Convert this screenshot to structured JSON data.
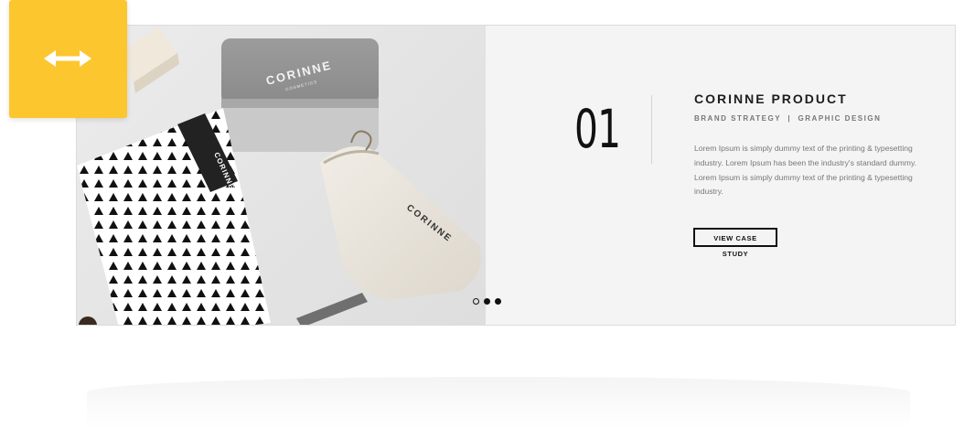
{
  "slide": {
    "number": "01",
    "title": "CORINNE PRODUCT",
    "tags": "BRAND STRATEGY  |  GRAPHIC DESIGN",
    "description": "Lorem Ipsum is simply dummy text of the printing & typesetting industry. Lorem Ipsum has been the industry's standard dummy. Lorem Ipsum is simply dummy text of the printing & typesetting industry.",
    "cta_label": "VIEW CASE STUDY"
  },
  "mockup": {
    "brand": "CORINNE",
    "brand_sub": "COSMETICS"
  },
  "pager": {
    "total": 3,
    "active_index": 0
  },
  "badge": {
    "icon": "horizontal-resize-arrow-icon",
    "color": "#fcc62e"
  }
}
